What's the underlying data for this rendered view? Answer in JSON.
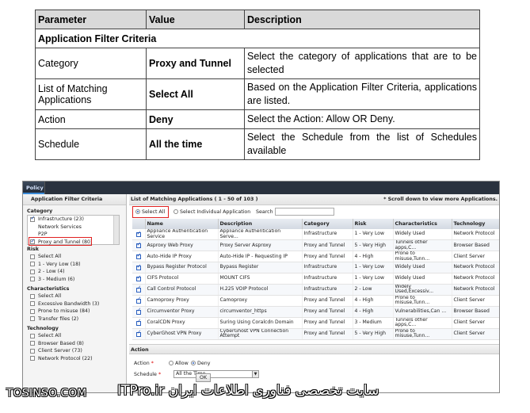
{
  "param_table": {
    "headers": [
      "Parameter",
      "Value",
      "Description"
    ],
    "section": "Application Filter Criteria",
    "rows": [
      {
        "param": "Category",
        "value": "Proxy and Tunnel",
        "desc": "Select the category of applications that are to be selected"
      },
      {
        "param": "List of Matching Applications",
        "value": "Select All",
        "desc": "Based on the Application Filter Criteria, applications are listed."
      },
      {
        "param": "Action",
        "value": "Deny",
        "desc": "Select the Action: Allow OR Deny."
      },
      {
        "param": "Schedule",
        "value": "All the time",
        "desc": "Select the Schedule from the list of Schedules available"
      }
    ]
  },
  "app": {
    "tab": "Policy",
    "left_title": "Application Filter Criteria",
    "category_label": "Category",
    "categories": [
      {
        "label": "Infrastructure (23)",
        "checked": true
      },
      {
        "label": "Network Services",
        "checked": false
      },
      {
        "label": "P2P",
        "checked": false
      },
      {
        "label": "Proxy and Tunnel (80)",
        "checked": true
      }
    ],
    "risk_label": "Risk",
    "risk": [
      "Select All",
      "1 - Very Low (18)",
      "2 - Low (4)",
      "3 - Medium (6)"
    ],
    "char_label": "Characteristics",
    "characteristics": [
      "Select All",
      "Excessive Bandwidth (3)",
      "Prone to misuse (84)",
      "Transfer files (2)"
    ],
    "tech_label": "Technology",
    "technology": [
      "Select All",
      "Browser Based (8)",
      "Client Server (73)",
      "Network Protocol (22)"
    ],
    "list_title": "List of Matching Applications ( 1 - 50 of 103 )",
    "scroll_note": "* Scroll down to view more Applications.",
    "select_all": "Select All",
    "select_individual": "Select Individual Application",
    "search_label": "Search",
    "columns": [
      "Name",
      "Description",
      "Category",
      "Risk",
      "Characteristics",
      "Technology"
    ],
    "rows": [
      [
        "Appliance Authentication Service",
        "Appliance Authentication Serve...",
        "Infrastructure",
        "1 - Very Low",
        "Widely Used",
        "Network Protocol"
      ],
      [
        "Asproxy Web Proxy",
        "Proxy Server Asproxy",
        "Proxy and Tunnel",
        "5 - Very High",
        "Tunnels other apps,C...",
        "Browser Based"
      ],
      [
        "Auto-Hide IP Proxy",
        "Auto-Hide IP - Requesting IP",
        "Proxy and Tunnel",
        "4 - High",
        "Prone to misuse,Tunn...",
        "Client Server"
      ],
      [
        "Bypass Register Protocol",
        "Bypass Register",
        "Infrastructure",
        "1 - Very Low",
        "Widely Used",
        "Network Protocol"
      ],
      [
        "CIFS Protocol",
        "MOUNT CIFS",
        "Infrastructure",
        "1 - Very Low",
        "Widely Used",
        "Network Protocol"
      ],
      [
        "Call Control Protocol",
        "H.225 VOIP Protocol",
        "Infrastructure",
        "2 - Low",
        "Widely Used,Excessiv...",
        "Network Protocol"
      ],
      [
        "Camoproxy Proxy",
        "Camoproxy",
        "Proxy and Tunnel",
        "4 - High",
        "Prone to misuse,Tunn...",
        "Client Server"
      ],
      [
        "Circumventor Proxy",
        "circumventor_https",
        "Proxy and Tunnel",
        "4 - High",
        "Vulnerabilities,Can ...",
        "Browser Based"
      ],
      [
        "CoralCDN Proxy",
        "Suring Using Coralcdn Domain",
        "Proxy and Tunnel",
        "3 - Medium",
        "Tunnels other apps,C...",
        "Client Server"
      ],
      [
        "CyberGhost VPN Proxy",
        "CyberGhost VPN Connection Attempt",
        "Proxy and Tunnel",
        "5 - Very High",
        "Prone to misuse,Tunn...",
        "Client Server"
      ]
    ],
    "action_title": "Action",
    "action_label": "Action",
    "allow_label": "Allow",
    "deny_label": "Deny",
    "schedule_label": "Schedule",
    "schedule_value": "All the Time",
    "ok_label": "OK"
  },
  "watermark": {
    "left": "TOSINSO.COM",
    "right": "سایت تخصصی فناوری اطلاعات ایران ITPro.ir"
  }
}
